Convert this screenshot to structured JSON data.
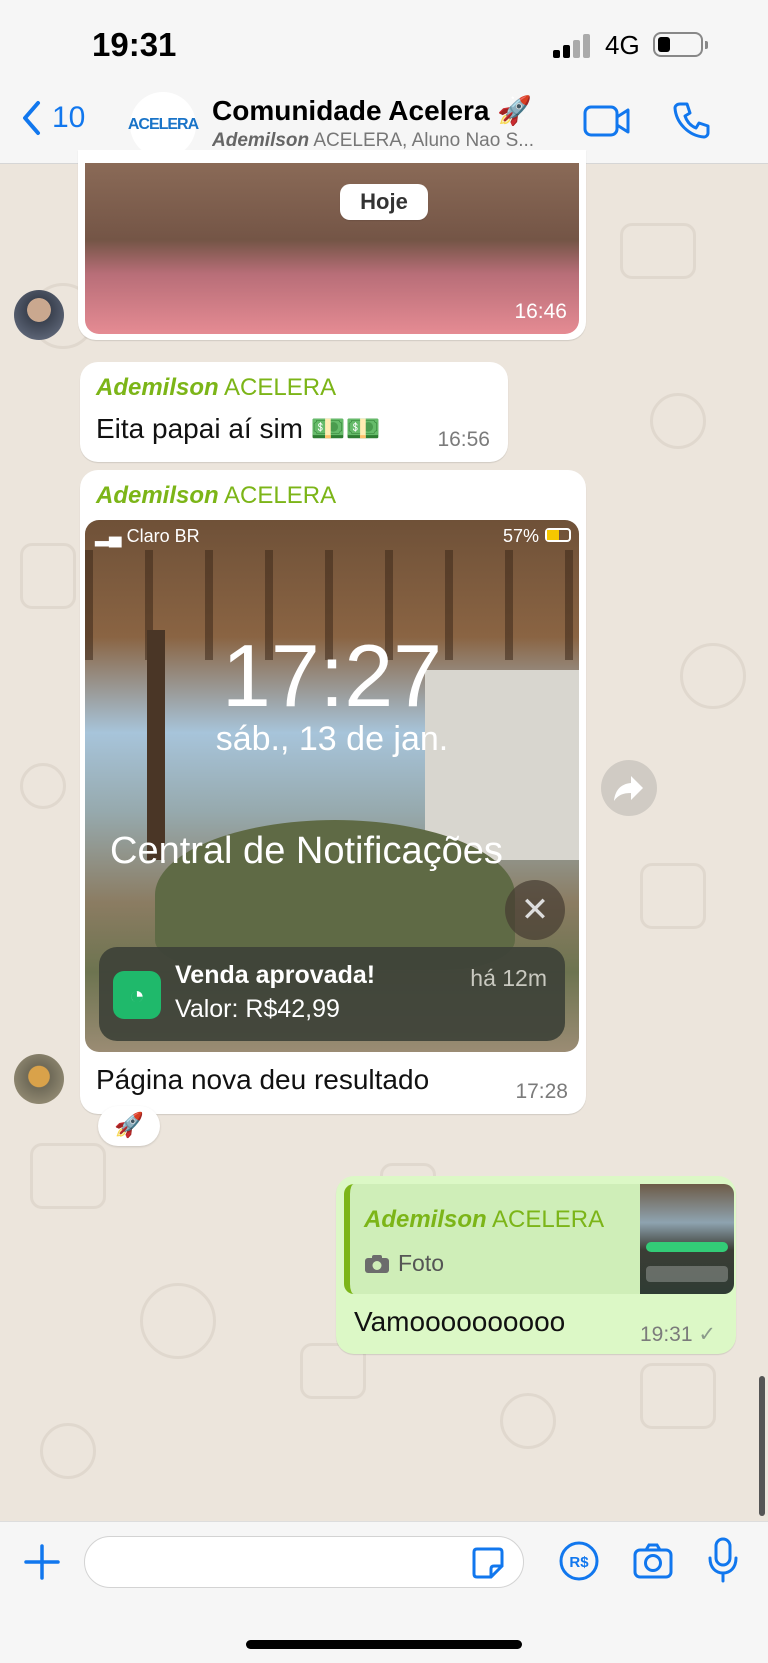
{
  "status_bar": {
    "time": "19:31",
    "network": "4G"
  },
  "header": {
    "back_count": "10",
    "group_logo_text": "ACELERA",
    "title": "Comunidade Acelera 🚀",
    "subtitle_bold": "Ademilson",
    "subtitle_rest": " ACELERA, Aluno Nao S..."
  },
  "messages": {
    "photo_1": {
      "time": "16:46"
    },
    "date_chip": "Hoje",
    "msg_2": {
      "sender_first": "Ademilson",
      "sender_rest": " ACELERA",
      "text": "Eita papai aí sim 💵💵",
      "time": "16:56"
    },
    "msg_3": {
      "sender_first": "Ademilson",
      "sender_rest": " ACELERA",
      "screenshot": {
        "carrier": "Claro BR",
        "battery": "57%",
        "clock": "17:27",
        "date": "sáb., 13 de jan.",
        "center_title": "Central de Notificações",
        "notification_title": "Venda aprovada!",
        "notification_body": "Valor: R$42,99",
        "notification_age": "há 12m"
      },
      "text": "Página nova deu resultado",
      "time": "17:28",
      "reaction": "🚀"
    },
    "msg_4": {
      "quote_sender_first": "Ademilson",
      "quote_sender_rest": " ACELERA",
      "quote_label": "Foto",
      "text": "Vamoooooooooo",
      "time": "19:31",
      "tick": "✓"
    }
  },
  "compose": {
    "placeholder": ""
  },
  "colors": {
    "accent": "#1177ee",
    "sender_name": "#7cb518",
    "outgoing_bubble": "#dcf8c6",
    "chat_background": "#ece5dc"
  }
}
